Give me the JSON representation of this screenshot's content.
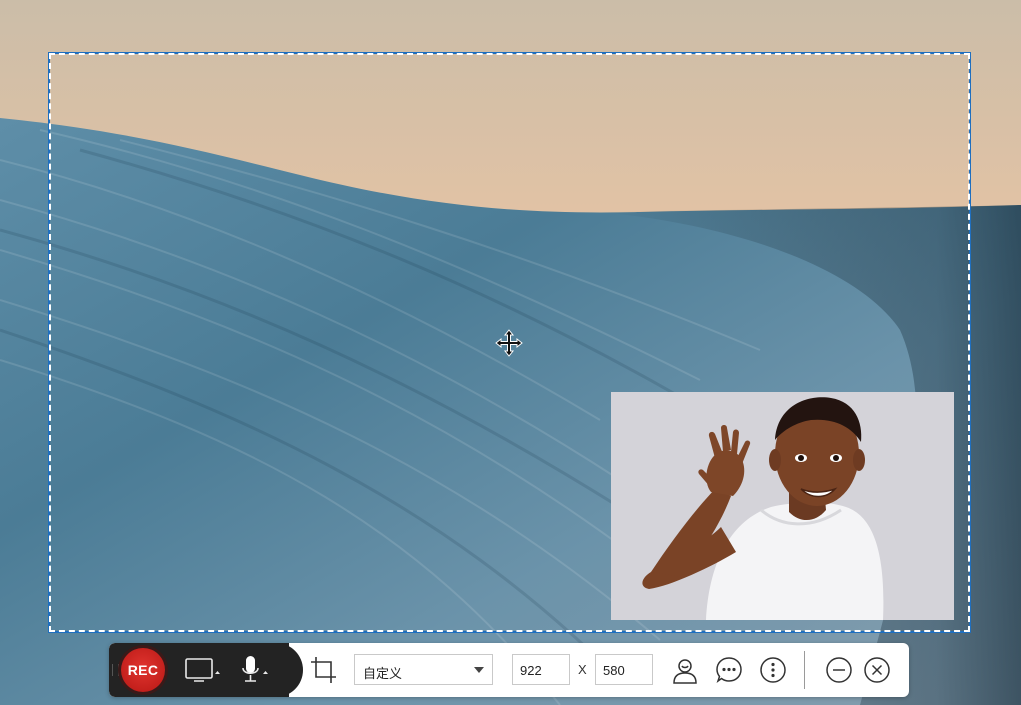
{
  "toolbar": {
    "rec_label": "REC",
    "size_preset": "自定义",
    "width_value": "922",
    "height_value": "580",
    "times_label": "X"
  },
  "icons": {
    "drag": "drag-handle-icon",
    "screen": "monitor-icon",
    "mic": "microphone-icon",
    "crop": "crop-icon",
    "webcam": "person-icon",
    "chat": "chat-bubble-icon",
    "more": "more-vertical-icon",
    "minimize": "minimize-icon",
    "close": "close-icon",
    "move": "move-cursor-icon"
  },
  "colors": {
    "rec": "#d0231f",
    "selection_border": "#1f6fbf",
    "toolbar_dark": "#232323"
  }
}
